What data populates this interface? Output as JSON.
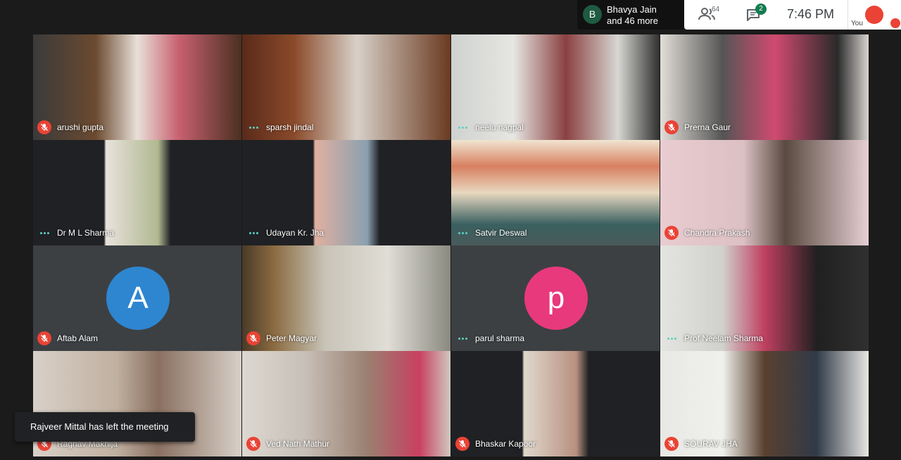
{
  "others": {
    "avatar_letter": "B",
    "name": "Bhavya Jain",
    "more": "and 46 more"
  },
  "topbar": {
    "people_count": "64",
    "chat_badge": "2",
    "time": "7:46 PM",
    "self_label": "You"
  },
  "participants": [
    {
      "name": "arushi gupta",
      "status": "muted"
    },
    {
      "name": "sparsh jindal",
      "status": "speaking"
    },
    {
      "name": "neelu nagpal",
      "status": "speaking"
    },
    {
      "name": "Prerna Gaur",
      "status": "muted"
    },
    {
      "name": "Dr M L Sharma",
      "status": "speaking"
    },
    {
      "name": "Udayan Kr. Jha",
      "status": "speaking"
    },
    {
      "name": "Satvir Deswal",
      "status": "speaking"
    },
    {
      "name": "Chandra Prakash",
      "status": "muted"
    },
    {
      "name": "Aftab Alam",
      "status": "muted",
      "avatar": "A",
      "avatar_color": "#2e86d1"
    },
    {
      "name": "Peter Magyar",
      "status": "muted"
    },
    {
      "name": "parul sharma",
      "status": "speaking",
      "avatar": "p",
      "avatar_color": "#e8397d"
    },
    {
      "name": "Prof Neelam Sharma",
      "status": "speaking"
    },
    {
      "name": "Raghav Makhija",
      "status": "muted"
    },
    {
      "name": "Ved Nath Mathur",
      "status": "muted"
    },
    {
      "name": "Bhaskar Kapoor",
      "status": "muted"
    },
    {
      "name": "SOURAV JHA",
      "status": "muted"
    }
  ],
  "toast": "Rajveer Mittal has left the meeting",
  "colors": {
    "accent": "#5bd0c1",
    "muted": "#ea4335",
    "badge": "#137c4f"
  }
}
